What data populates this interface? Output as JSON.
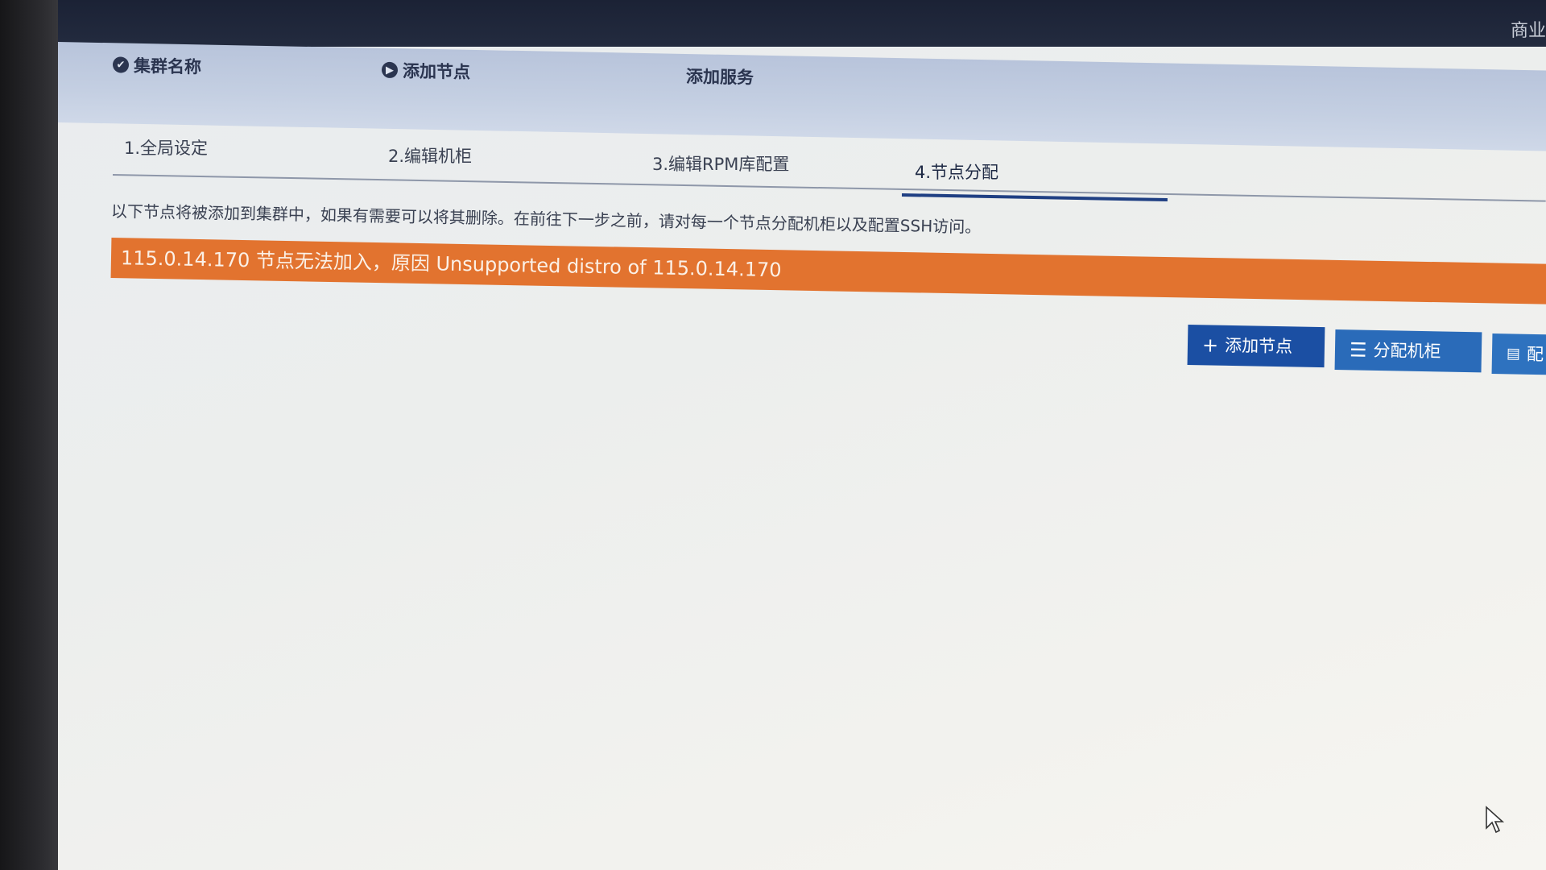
{
  "app_bar": {
    "right_text": "商业"
  },
  "wizard": {
    "steps": [
      {
        "label": "集群名称",
        "icon": "check-circle-icon"
      },
      {
        "label": "添加节点",
        "icon": "play-circle-icon"
      },
      {
        "label": "添加服务",
        "icon": ""
      }
    ]
  },
  "subtabs": [
    {
      "label": "1.全局设定"
    },
    {
      "label": "2.编辑机柜"
    },
    {
      "label": "3.编辑RPM库配置"
    },
    {
      "label": "4.节点分配",
      "active": true
    }
  ],
  "description": "以下节点将被添加到集群中，如果有需要可以将其删除。在前往下一步之前，请对每一个节点分配机柜以及配置SSH访问。",
  "alert": {
    "text": "115.0.14.170 节点无法加入，原因 Unsupported distro of 115.0.14.170",
    "color": "#e2732f"
  },
  "toolbar": {
    "add_node_label": "添加节点",
    "assign_rack_label": "分配机柜",
    "third_label": "配"
  },
  "colors": {
    "primary_button": "#1b4fa3",
    "secondary_button": "#2a6bb9",
    "header": "#232b3f"
  }
}
